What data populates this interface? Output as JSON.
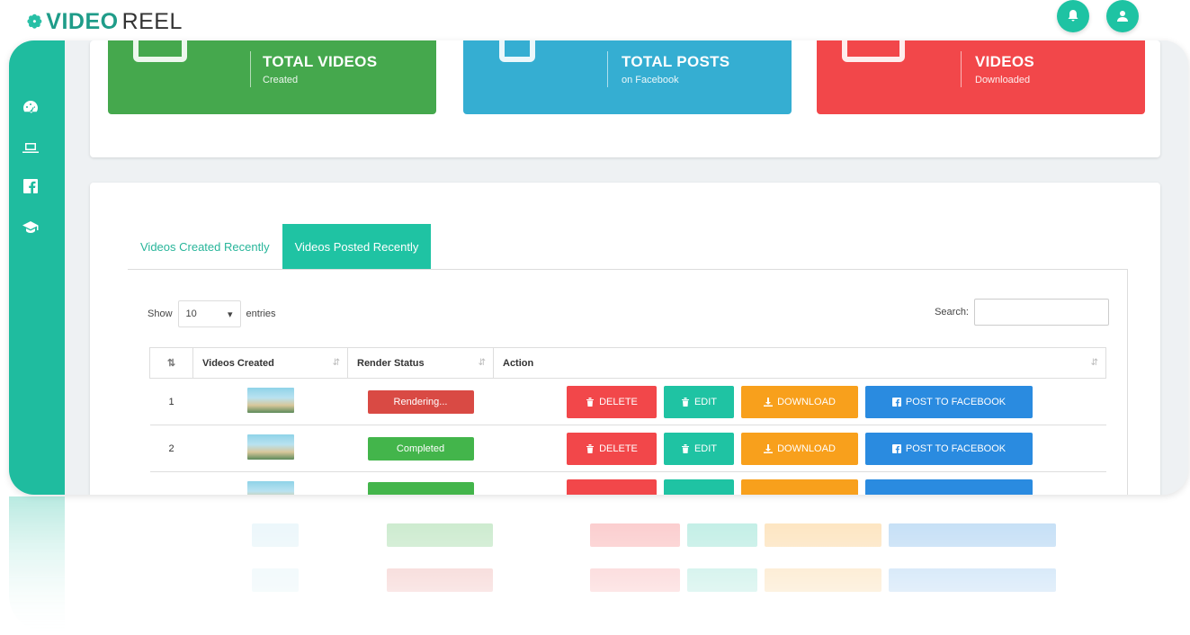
{
  "brand": {
    "logo_prefix": "VIDEO",
    "logo_suffix": "REEL"
  },
  "stats": [
    {
      "title": "TOTAL VIDEOS",
      "subtitle": "Created",
      "color": "#45a84d"
    },
    {
      "title": "TOTAL POSTS",
      "subtitle": "on Facebook",
      "color": "#35aed2"
    },
    {
      "title": "VIDEOS",
      "subtitle": "Downloaded",
      "color": "#f2474a"
    }
  ],
  "tabs": [
    {
      "label": "Videos Created Recently",
      "active": false
    },
    {
      "label": "Videos Posted Recently",
      "active": true
    }
  ],
  "table_controls": {
    "show_label": "Show",
    "entries_value": "10",
    "entries_label": "entries",
    "search_label": "Search:",
    "search_value": ""
  },
  "table": {
    "columns": [
      "Videos Created",
      "Render Status",
      "Action"
    ],
    "rows": [
      {
        "num": "1",
        "status": "Rendering...",
        "status_color": "#d94a44"
      },
      {
        "num": "2",
        "status": "Completed",
        "status_color": "#43b54b"
      }
    ],
    "actions": {
      "delete": "DELETE",
      "edit": "EDIT",
      "download": "DOWNLOAD",
      "post": "POST TO FACEBOOK"
    }
  },
  "sidebar_icons": [
    "dashboard-icon",
    "laptop-icon",
    "facebook-icon",
    "graduation-cap-icon"
  ],
  "colors": {
    "accent": "#1fc3a3",
    "sidebar": "#1fbc9f",
    "delete": "#f2474a",
    "download": "#f8a01c",
    "facebook": "#2a8be0"
  }
}
